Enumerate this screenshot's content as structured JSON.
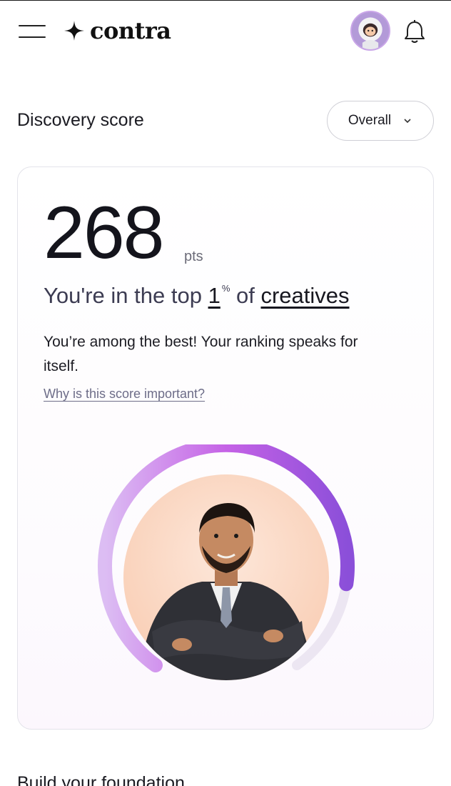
{
  "header": {
    "logo_text": "contra",
    "icons": [
      "menu-icon",
      "contra-star-icon",
      "avatar",
      "bell-icon"
    ]
  },
  "discovery": {
    "title": "Discovery score",
    "filter_selected": "Overall"
  },
  "score": {
    "value": "268",
    "unit": "pts",
    "rank_prefix": "You're in the top ",
    "rank_number": "1",
    "rank_symbol": "%",
    "rank_middle": " of ",
    "rank_group": "creatives",
    "description": "You’re among the best! Your ranking speaks for itself.",
    "why_link": "Why is this score important?",
    "gauge_fraction": 0.84
  },
  "next_section": {
    "title": "Build your foundation"
  },
  "colors": {
    "gauge_start": "#dcbdf3",
    "gauge_mid": "#c562e6",
    "gauge_end": "#8b4fd9",
    "photo_bg": "#f8c8ac",
    "link": "#6d6d88"
  }
}
